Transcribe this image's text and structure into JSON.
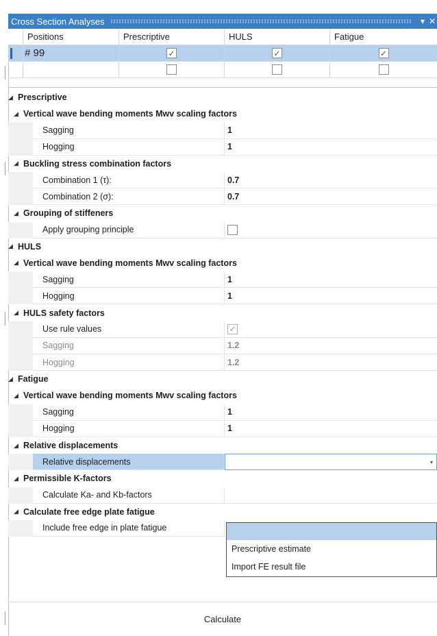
{
  "window": {
    "title": "Cross Section Analyses",
    "dropdown_glyph": "▾",
    "close_glyph": "✕"
  },
  "positions_grid": {
    "columns": [
      "Positions",
      "Prescriptive",
      "HULS",
      "Fatigue"
    ],
    "rows": [
      {
        "id": "# 99",
        "prescriptive": true,
        "huls": true,
        "fatigue": true,
        "selected": true
      },
      {
        "id": "",
        "prescriptive": false,
        "huls": false,
        "fatigue": false,
        "selected": false
      }
    ]
  },
  "properties": {
    "prescriptive": {
      "label": "Prescriptive",
      "mwv": {
        "label": "Vertical wave bending moments Mwv scaling factors",
        "sagging_label": "Sagging",
        "sagging": "1",
        "hogging_label": "Hogging",
        "hogging": "1"
      },
      "buckling": {
        "label": "Buckling stress combination factors",
        "c1_label": "Combination 1 (τ):",
        "c1": "0.7",
        "c2_label": "Combination 2 (σ):",
        "c2": "0.7"
      },
      "grouping": {
        "label": "Grouping of stiffeners",
        "apply_label": "Apply grouping principle",
        "apply": false
      }
    },
    "huls": {
      "label": "HULS",
      "mwv": {
        "label": "Vertical wave bending moments Mwv scaling factors",
        "sagging_label": "Sagging",
        "sagging": "1",
        "hogging_label": "Hogging",
        "hogging": "1"
      },
      "safety": {
        "label": "HULS safety factors",
        "use_rule_label": "Use rule values",
        "use_rule": true,
        "sagging_label": "Sagging",
        "sagging": "1.2",
        "hogging_label": "Hogging",
        "hogging": "1.2"
      }
    },
    "fatigue": {
      "label": "Fatigue",
      "mwv": {
        "label": "Vertical wave bending moments Mwv scaling factors",
        "sagging_label": "Sagging",
        "sagging": "1",
        "hogging_label": "Hogging",
        "hogging": "1"
      },
      "reldisp": {
        "label": "Relative displacements",
        "item_label": "Relative displacements",
        "value": ""
      },
      "kfactors": {
        "label": "Permissible K-factors",
        "item_label": "Calculate Ka- and Kb-factors"
      },
      "freeedge": {
        "label": "Calculate free edge plate fatigue",
        "item_label": "Include free edge in plate fatigue",
        "include": false
      }
    }
  },
  "dropdown_options": [
    "",
    "Prescriptive estimate",
    "Import FE result file"
  ],
  "calculate_label": "Calculate",
  "glyphs": {
    "expand_arrow": "◢",
    "check": "✓"
  }
}
